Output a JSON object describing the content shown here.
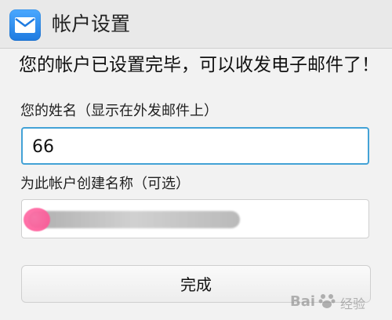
{
  "header": {
    "title": "帐户设置",
    "icon_name": "mail-icon"
  },
  "message": "您的帐户已设置完毕，可以收发电子邮件了！",
  "form": {
    "name_label": "您的姓名（显示在外发邮件上）",
    "name_value": "66",
    "account_label": "为此帐户创建名称（可选）",
    "account_value": ""
  },
  "actions": {
    "finish_label": "完成"
  },
  "watermark": {
    "brand": "Bai",
    "suffix": "经验"
  },
  "colors": {
    "accent": "#43a2d6",
    "header_bg": "#e9e9e9",
    "background": "#f2f2f2"
  }
}
